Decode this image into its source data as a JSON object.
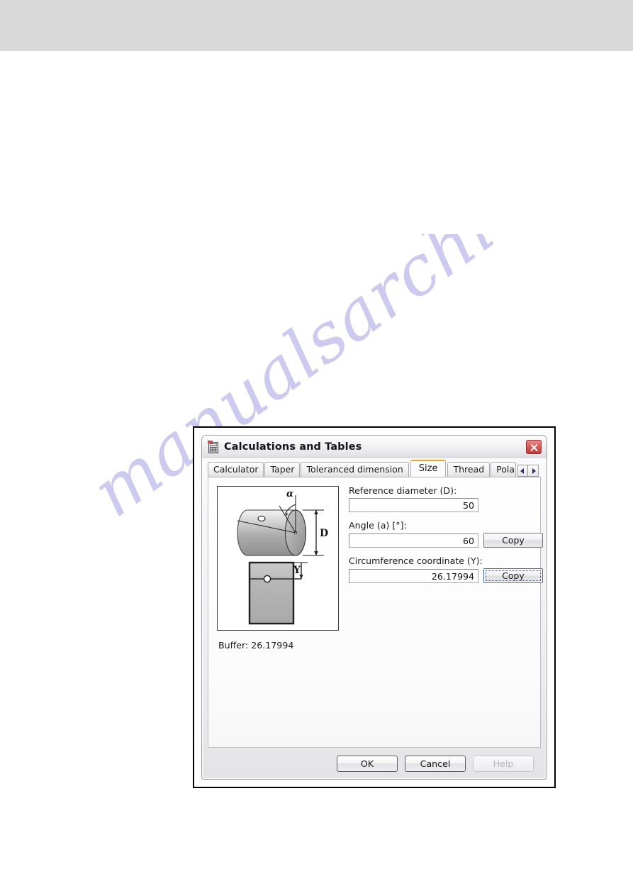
{
  "page": {
    "band_color": "#d9d9d9",
    "watermark_text": "manualsarchive.com"
  },
  "dialog": {
    "title": "Calculations and Tables",
    "title_icon": "calculator-icon",
    "close_icon": "close-icon",
    "tabs": [
      {
        "label": "Calculator",
        "active": false
      },
      {
        "label": "Taper",
        "active": false
      },
      {
        "label": "Toleranced dimension",
        "active": false
      },
      {
        "label": "Size",
        "active": true
      },
      {
        "label": "Thread",
        "active": false
      },
      {
        "label": "Polar",
        "active": false
      }
    ],
    "tab_scroll": {
      "left_icon": "chevron-left-icon",
      "right_icon": "chevron-right-icon"
    },
    "illustration": {
      "alt": "cylinder-unrolled-circumference-diagram",
      "labels": {
        "angle": "α",
        "diameter": "D",
        "coordinate": "Y"
      }
    },
    "fields": [
      {
        "label": "Reference diameter (D):",
        "value": "50",
        "has_copy": false
      },
      {
        "label": "Angle (a) [°]:",
        "value": "60",
        "has_copy": true,
        "copy_label": "Copy",
        "copy_focused": false
      },
      {
        "label": "Circumference coordinate (Y):",
        "value": "26.17994",
        "has_copy": true,
        "copy_label": "Copy",
        "copy_focused": true
      }
    ],
    "buffer": "Buffer: 26.17994",
    "footer": {
      "ok": "OK",
      "cancel": "Cancel",
      "help": "Help",
      "help_disabled": true
    },
    "accent_color": "#f3a626"
  }
}
